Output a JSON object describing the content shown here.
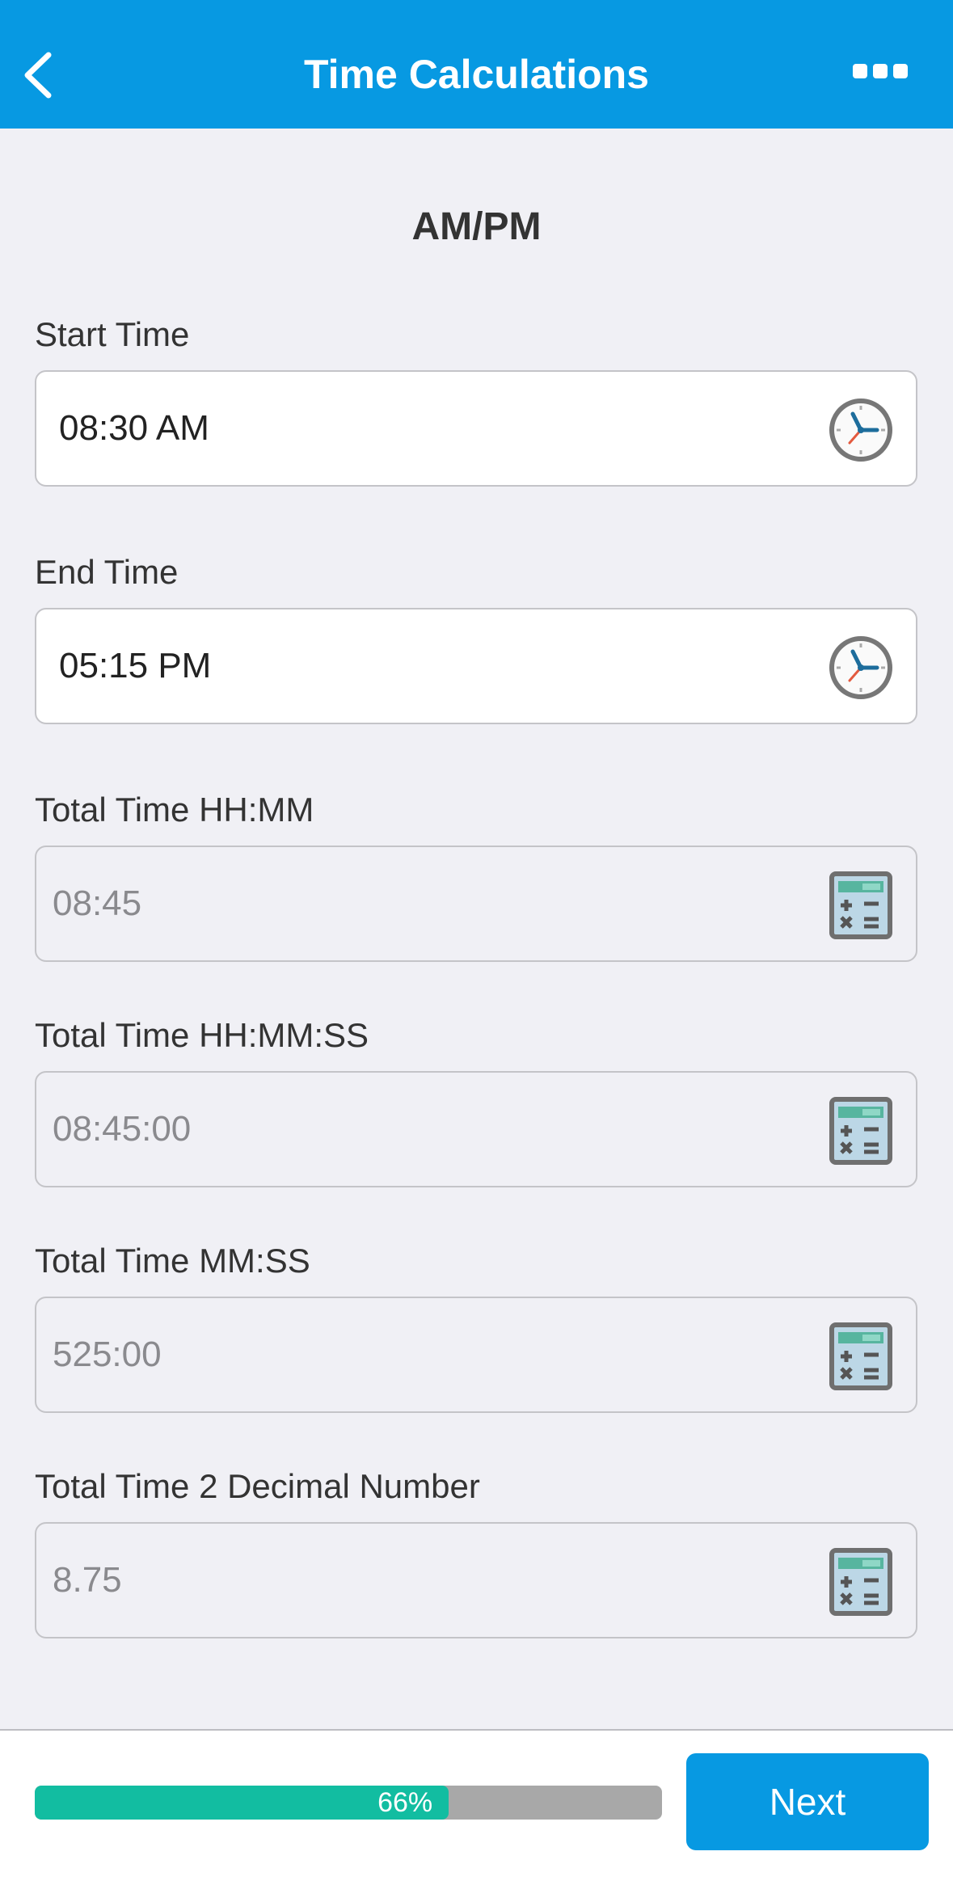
{
  "header": {
    "title": "Time Calculations"
  },
  "section": {
    "title": "AM/PM"
  },
  "fields": [
    {
      "label": "Start Time",
      "value": "08:30 AM",
      "icon": "clock-icon",
      "editable": true
    },
    {
      "label": "End Time",
      "value": "05:15 PM",
      "icon": "clock-icon",
      "editable": true
    },
    {
      "label": "Total Time HH:MM",
      "value": "08:45",
      "icon": "calculator-icon",
      "editable": false
    },
    {
      "label": "Total Time HH:MM:SS",
      "value": "08:45:00",
      "icon": "calculator-icon",
      "editable": false
    },
    {
      "label": "Total Time MM:SS",
      "value": "525:00",
      "icon": "calculator-icon",
      "editable": false
    },
    {
      "label": "Total Time 2 Decimal Number",
      "value": "8.75",
      "icon": "calculator-icon",
      "editable": false
    }
  ],
  "footer": {
    "progress_percent": 66,
    "progress_label": "66%",
    "next_label": "Next"
  },
  "colors": {
    "header": "#0799e2",
    "progress_fill": "#12bda1",
    "progress_track": "#a8a8a8",
    "button": "#0799e2"
  }
}
